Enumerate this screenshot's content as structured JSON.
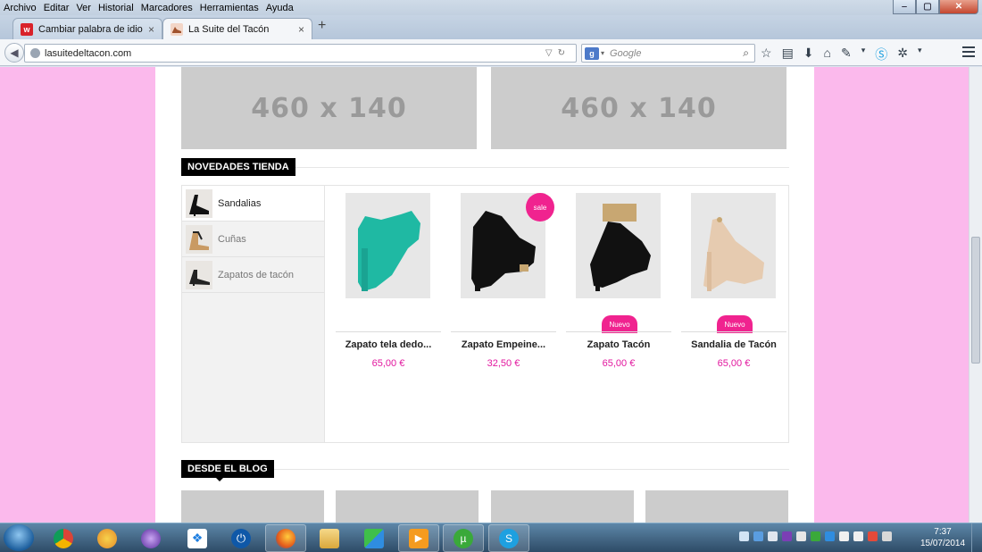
{
  "menubar": {
    "items": [
      "Archivo",
      "Editar",
      "Ver",
      "Historial",
      "Marcadores",
      "Herramientas",
      "Ayuda"
    ]
  },
  "window_controls": {
    "minimize": "‒",
    "maximize": "▢",
    "close": "✕"
  },
  "tabs": [
    {
      "label": "Cambiar palabra de idioma...",
      "favicon": "w-red-icon",
      "favicon_glyph": "w",
      "close": "×"
    },
    {
      "label": "La Suite del Tacón",
      "favicon": "shoe-icon",
      "favicon_glyph": "",
      "close": "×"
    }
  ],
  "newtab_label": "+",
  "navbar": {
    "url": "lasuitedeltacon.com",
    "search_placeholder": "Google",
    "search_engine_glyph": "g"
  },
  "banners": [
    "460 x 140",
    "460 x 140"
  ],
  "store": {
    "section_title": "NOVEDADES TIENDA",
    "categories": [
      {
        "label": "Sandalias",
        "active": true
      },
      {
        "label": "Cuñas",
        "active": false
      },
      {
        "label": "Zapatos de tacón",
        "active": false
      }
    ],
    "products": [
      {
        "name": "Zapato tela dedo...",
        "price": "65,00 €",
        "badge": "",
        "color": "#1fb9a3"
      },
      {
        "name": "Zapato Empeine...",
        "price": "32,50 €",
        "badge": "sale",
        "color": "#111111"
      },
      {
        "name": "Zapato Tacón",
        "price": "65,00 €",
        "badge": "Nuevo",
        "color": "#111111"
      },
      {
        "name": "Sandalia de Tacón",
        "price": "65,00 €",
        "badge": "Nuevo",
        "color": "#e6cbb0"
      }
    ]
  },
  "blog": {
    "section_title": "DESDE EL BLOG"
  },
  "taskbar": {
    "time": "7:37",
    "date": "15/07/2014"
  },
  "colors": {
    "accent_pink": "#f0238f",
    "page_bg": "#fbb9ec",
    "price": "#e2189f"
  }
}
